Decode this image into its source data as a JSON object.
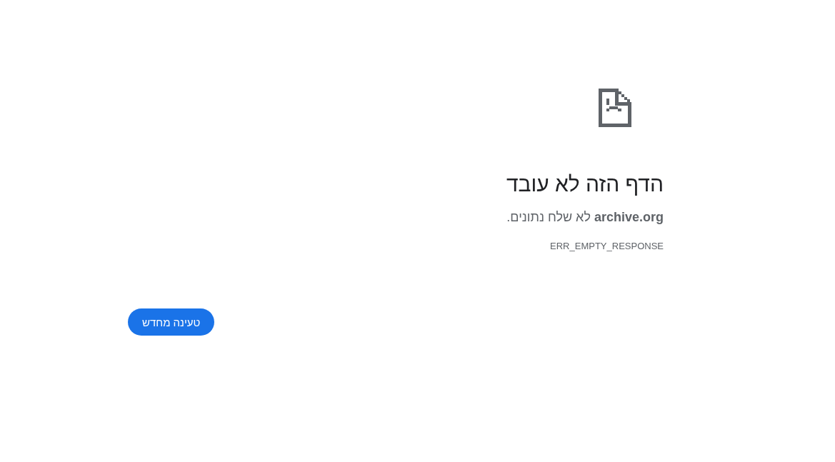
{
  "error": {
    "title": "הדף הזה לא עובד",
    "message": "**archive.org** לא שלח נתונים.",
    "code": "ERR_EMPTY_RESPONSE"
  },
  "buttons": [
    {
      "label": "טעינה מחדש",
      "kind": "primary"
    }
  ]
}
